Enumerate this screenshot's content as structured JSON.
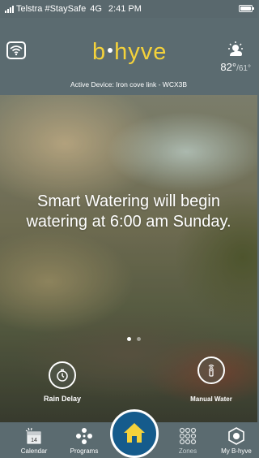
{
  "status_bar": {
    "carrier": "Telstra #StaySafe",
    "network": "4G",
    "time": "2:41 PM"
  },
  "header": {
    "logo_b": "b",
    "logo_rest": "hyve",
    "weather_icon": "partly-sunny-icon",
    "temp_high": "82°",
    "temp_low": "/61°",
    "active_device": "Active Device: Iron cove link - WCX3B"
  },
  "hero": {
    "message": "Smart Watering will begin watering at 6:00 am Sunday.",
    "page_count": 2,
    "current_page": 1
  },
  "actions": {
    "rain_delay_label": "Rain Delay",
    "manual_water_label": "Manual Water"
  },
  "tabs": {
    "calendar": {
      "label": "Calendar",
      "day": "14",
      "icon": "calendar-icon"
    },
    "programs": {
      "label": "Programs",
      "icon": "programs-icon"
    },
    "home": {
      "icon": "home-icon"
    },
    "zones": {
      "label": "Zones",
      "icon": "zones-grid-icon"
    },
    "my_bhyve": {
      "label": "My B-hyve",
      "icon": "my-bhyve-icon"
    }
  },
  "colors": {
    "header_bg": "#5b6b70",
    "logo_yellow": "#f4d23b",
    "home_blue": "#155b8c",
    "sun_yellow": "#f4d23b"
  }
}
